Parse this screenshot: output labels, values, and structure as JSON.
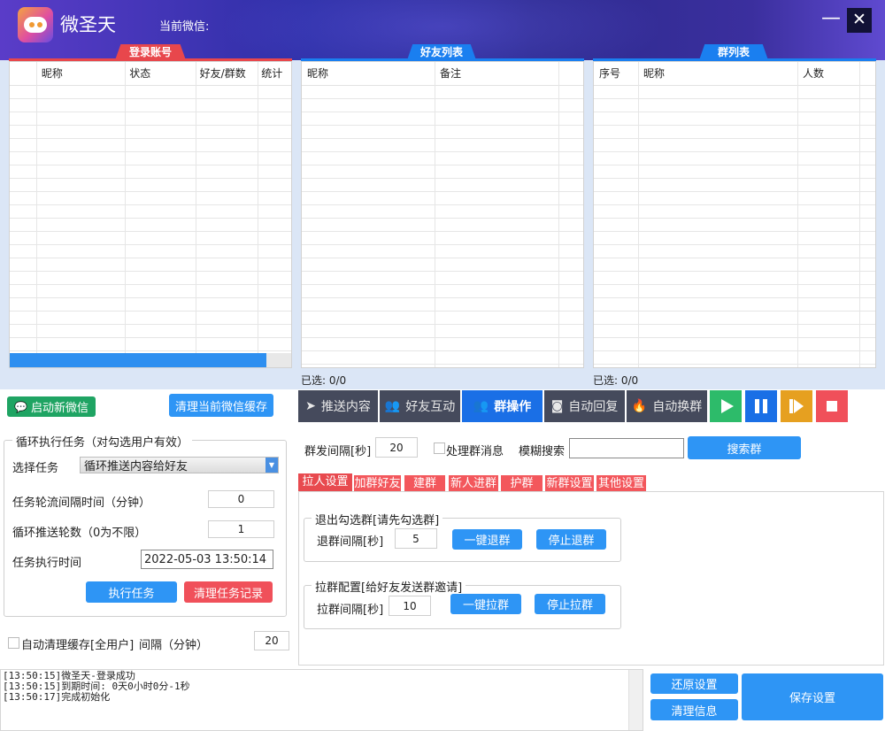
{
  "app": {
    "name": "微圣天",
    "current_wechat_label": "当前微信:",
    "minimize": "—",
    "close": "✕"
  },
  "panels": {
    "accounts": {
      "title": "登录账号",
      "columns": [
        "昵称",
        "状态",
        "好友/群数",
        "统计"
      ]
    },
    "friends": {
      "title": "好友列表",
      "columns": [
        "昵称",
        "备注"
      ],
      "selected": "已选: 0/0"
    },
    "groups": {
      "title": "群列表",
      "columns": [
        "序号",
        "昵称",
        "人数"
      ],
      "selected": "已选: 0/0"
    }
  },
  "left": {
    "start_wechat": "启动新微信",
    "clear_cache": "清理当前微信缓存",
    "loop_group_title": "循环执行任务（对勾选用户有效）",
    "select_task_label": "选择任务",
    "select_task_value": "循环推送内容给好友",
    "interval_label": "任务轮流间隔时间（分钟）",
    "interval_value": "0",
    "rounds_label": "循环推送轮数（0为不限）",
    "rounds_value": "1",
    "exec_time_label": "任务执行时间",
    "exec_time_value": "2022-05-03 13:50:14",
    "run_task": "执行任务",
    "clear_task": "清理任务记录",
    "auto_clear_label": "自动清理缓存[全用户]",
    "auto_interval_label": "间隔（分钟）",
    "auto_interval_value": "20"
  },
  "toolbar": {
    "tabs": [
      {
        "label": "推送内容",
        "icon": "send-icon"
      },
      {
        "label": "好友互动",
        "icon": "users-icon"
      },
      {
        "label": "群操作",
        "icon": "group-icon"
      },
      {
        "label": "自动回复",
        "icon": "robot-icon"
      },
      {
        "label": "自动换群",
        "icon": "flame-icon"
      }
    ],
    "active": "群操作",
    "controls": [
      {
        "name": "play",
        "color": "#2dbb6a"
      },
      {
        "name": "pause",
        "color": "#1a6fe6"
      },
      {
        "name": "skip",
        "color": "#e6a020"
      },
      {
        "name": "stop",
        "color": "#f0505a"
      }
    ]
  },
  "group_ops": {
    "interval_label": "群发间隔[秒]",
    "interval_value": "20",
    "process_msg_label": "处理群消息",
    "fuzzy_label": "模糊搜索",
    "search_value": "",
    "search_button": "搜索群",
    "subtabs": [
      "拉人设置",
      "加群好友",
      "建群",
      "新人进群",
      "护群",
      "新群设置",
      "其他设置"
    ],
    "quit": {
      "title": "退出勾选群[请先勾选群]",
      "interval_label": "退群间隔[秒]",
      "interval_value": "5",
      "one_click": "一键退群",
      "stop": "停止退群"
    },
    "pull": {
      "title": "拉群配置[给好友发送群邀请]",
      "interval_label": "拉群间隔[秒]",
      "interval_value": "10",
      "one_click": "一键拉群",
      "stop": "停止拉群"
    }
  },
  "log": {
    "lines": [
      "[13:50:15]微圣天-登录成功",
      "[13:50:15]到期时间: 0天0小时0分-1秒",
      "[13:50:17]完成初始化"
    ]
  },
  "bottom": {
    "restore": "还原设置",
    "clear_info": "清理信息",
    "save": "保存设置"
  }
}
